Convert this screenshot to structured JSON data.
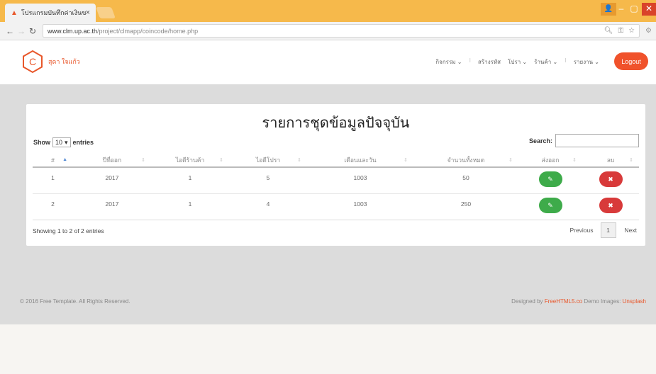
{
  "browser": {
    "tab_title": "โปรแกรมบันทึกค่าเงินของกา",
    "tab_close": "×",
    "url_host": "www.clm.up.ac.th",
    "url_path": "/project/clmapp/coincode/home.php"
  },
  "header": {
    "brand_letter": "C",
    "brand_name": "สุดา ใจแก้ว",
    "menu": [
      "กิจกรรม ⌄",
      "สร้างรหัส",
      "โปรา ⌄",
      "ร้านค้า ⌄",
      "รายงาน ⌄"
    ],
    "logout_label": "Logout"
  },
  "card": {
    "title": "รายการชุดข้อมูลปัจจุบัน",
    "show_label": "Show",
    "show_value": "10",
    "entries_label": "entries",
    "search_label": "Search:",
    "columns": [
      "#",
      "ปีที่ออก",
      "ไอดีร้านค้า",
      "ไอดีโปรา",
      "เดือนและวัน",
      "จำนวนทั้งหมด",
      "ส่งออก",
      "ลบ"
    ],
    "rows": [
      {
        "num": "1",
        "year": "2017",
        "shop": "1",
        "promo": "5",
        "date": "1003",
        "total": "50"
      },
      {
        "num": "2",
        "year": "2017",
        "shop": "1",
        "promo": "4",
        "date": "1003",
        "total": "250"
      }
    ],
    "info": "Showing 1 to 2 of 2 entries",
    "pager": {
      "prev": "Previous",
      "page": "1",
      "next": "Next"
    }
  },
  "footer": {
    "copyright": "© 2016 Free Template. All Rights Reserved.",
    "designed_by": "Designed by",
    "designer": "FreeHTML5.co",
    "demo_images": "Demo Images:",
    "images_src": "Unsplash"
  },
  "colors": {
    "accent": "#f0522b",
    "edit": "#3eab4a",
    "delete": "#d83a3a"
  }
}
